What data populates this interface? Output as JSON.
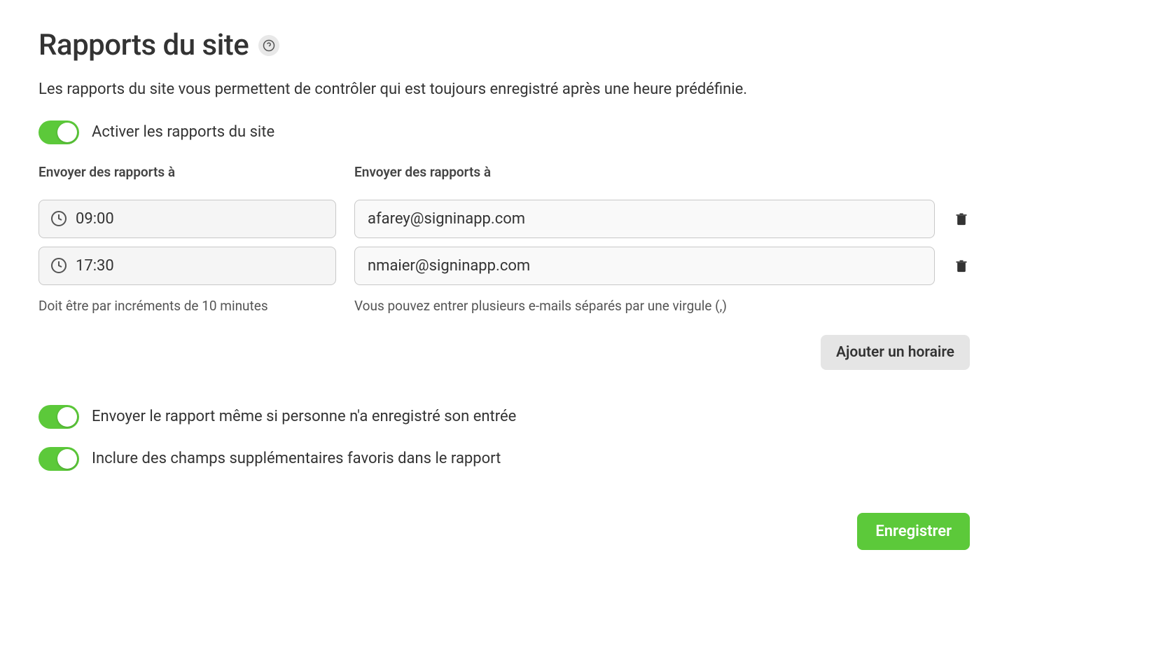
{
  "title": "Rapports du site",
  "description": "Les rapports du site vous permettent de contrôler qui est toujours enregistré après une heure prédéfinie.",
  "toggles": {
    "enable_reports": {
      "label": "Activer les rapports du site",
      "on": true
    },
    "send_if_empty": {
      "label": "Envoyer le rapport même si personne n'a enregistré son entrée",
      "on": true
    },
    "include_favorites": {
      "label": "Inclure des champs supplémentaires favoris dans le rapport",
      "on": true
    }
  },
  "labels": {
    "time_column": "Envoyer des rapports à",
    "email_column": "Envoyer des rapports à"
  },
  "rows": [
    {
      "time": "09:00",
      "email": "afarey@signinapp.com"
    },
    {
      "time": "17:30",
      "email": "nmaier@signinapp.com"
    }
  ],
  "hints": {
    "time": "Doit être par incréments de 10 minutes",
    "email": "Vous pouvez entrer plusieurs e-mails séparés par une virgule (,)"
  },
  "buttons": {
    "add_schedule": "Ajouter un horaire",
    "save": "Enregistrer"
  }
}
